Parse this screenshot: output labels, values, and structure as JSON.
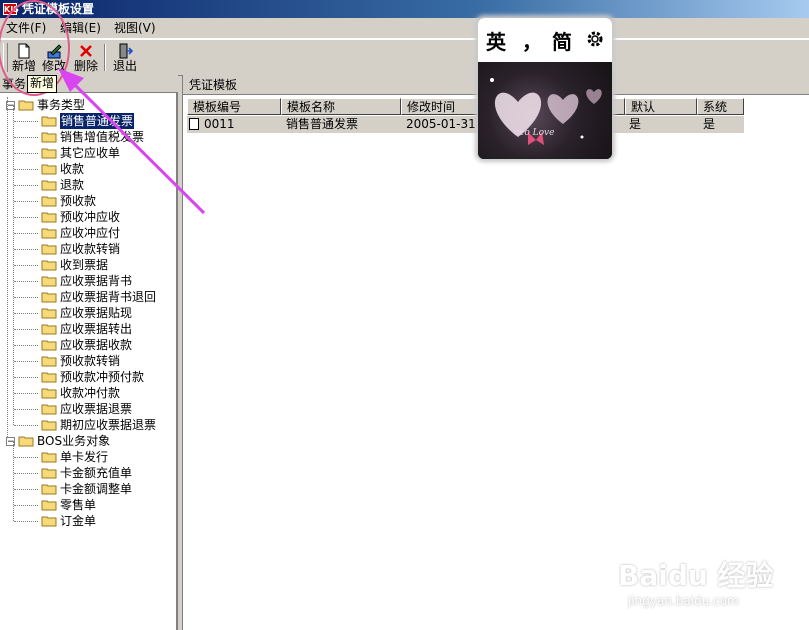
{
  "window": {
    "title": "凭证模板设置",
    "app_icon": "KIS"
  },
  "menu": [
    {
      "label": "文件(F)"
    },
    {
      "label": "编辑(E)"
    },
    {
      "label": "视图(V)"
    }
  ],
  "toolbar": {
    "new_label": "新增",
    "edit_label": "修改",
    "delete_label": "删除",
    "exit_label": "退出",
    "tooltip": "新增"
  },
  "left_panel": {
    "header": "事务",
    "tree": {
      "group1_label": "事务类型",
      "group1_items": [
        "销售普通发票",
        "销售增值税发票",
        "其它应收单",
        "收款",
        "退款",
        "预收款",
        "预收冲应收",
        "应收冲应付",
        "应收款转销",
        "收到票据",
        "应收票据背书",
        "应收票据背书退回",
        "应收票据贴现",
        "应收票据转出",
        "应收票据收款",
        "预收款转销",
        "预收款冲预付款",
        "收款冲付款",
        "应收票据退票",
        "期初应收票据退票"
      ],
      "group2_label": "BOS业务对象",
      "group2_items": [
        "单卡发行",
        "卡金额充值单",
        "卡金额调整单",
        "零售单",
        "订金单"
      ]
    }
  },
  "right_panel": {
    "title": "凭证模板",
    "columns": [
      "模板编号",
      "模板名称",
      "修改时间",
      "默认",
      "系统"
    ],
    "rows": [
      {
        "code": "0011",
        "name": "销售普通发票",
        "time": "2005-01-31 1",
        "default": "是",
        "system": "是"
      }
    ]
  },
  "ime": {
    "k1": "英",
    "k2": "，",
    "k3": "简",
    "art_text": "ceo Love"
  },
  "watermark": {
    "brand": "Baidu 经验",
    "url": "jingyan.baidu.com"
  },
  "colors": {
    "selection": "#0a246a",
    "annotation": "#e05a8a",
    "arrow": "#d946ef"
  }
}
